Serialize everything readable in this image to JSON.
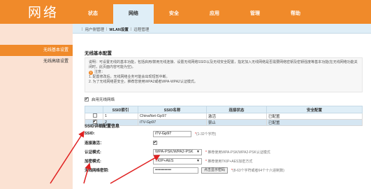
{
  "header": {
    "logo": "网络",
    "nav": [
      "状态",
      "网络",
      "安全",
      "应用",
      "管理",
      "帮助"
    ],
    "active_index": 1
  },
  "subnav": {
    "items": [
      "用户侧管理",
      "WLAN设置",
      "远程管理"
    ],
    "active_index": 1
  },
  "sidebar": {
    "items": [
      "无线基本设置",
      "无线高级设置"
    ]
  },
  "main": {
    "section_title": "无线基本配置",
    "description": "说明：可设置无线的基本功能，包括启用/禁用无线连接、设置无线网络SSID以及无线安全配置，指定加入无线网络是否需要网络密钥及密钥强度等基本功能(在无线网络功能关闭时，此页面内容可能为空)。",
    "note_title": "注意：",
    "notes": [
      "1. 配置修改后，无线网络业务可能会出现短暂中断。",
      "2. 为了无线网络更安全，推荐您使用WPA2或者WPA-WPA2认证模式。"
    ],
    "enable_label": "启用无线网络",
    "table": {
      "headers": [
        "",
        "SSID索引",
        "SSID名称",
        "连接状态",
        "安全配置"
      ],
      "rows": [
        {
          "index": "1",
          "name": "ChinaNet-Gp97",
          "status": "激活",
          "security": "已配置",
          "checked": false
        },
        {
          "index": "2",
          "name": "iTV-Gp97",
          "status": "禁止",
          "security": "已配置",
          "checked": true
        }
      ]
    },
    "detail": {
      "title": "SSID详细配置信息",
      "ssid_label": "SSID:",
      "ssid_value": "iTV-Gp97",
      "ssid_hint_star": "*",
      "ssid_hint": "(1-32个字符)",
      "connect_label": "连接激活：",
      "auth_label": "认证模式:",
      "auth_value": "WPA-PSK/WPA2-PSK",
      "auth_hint": "推荐使用WPA-PSK/WPA2-PSK认证模式",
      "encrypt_label": "加密模式:",
      "encrypt_value": "TKIP+AES",
      "encrypt_hint": "推荐使用TKIP+AES加密方式",
      "key_label": "无线网络密钥:",
      "key_value": "••••••••••••",
      "show_pwd_label": "点击显示密码",
      "key_hint_star": "*",
      "key_hint": "(8-63个字符或者64个十六进制数)"
    }
  },
  "colors": {
    "brand_orange": "#f08a2a",
    "light_blue": "#dfeef7",
    "annotation_red": "#e02020"
  }
}
